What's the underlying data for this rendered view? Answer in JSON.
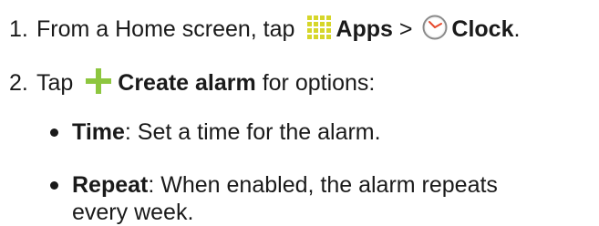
{
  "steps": [
    {
      "number": "1.",
      "pre_text": "From a Home screen, tap ",
      "apps_label": "Apps",
      "separator": " > ",
      "clock_label": "Clock",
      "end_text": "."
    },
    {
      "number": "2.",
      "pre_text": "Tap ",
      "action_label": "Create alarm",
      "post_text": " for options:"
    }
  ],
  "options": [
    {
      "term": "Time",
      "description": ": Set a time for the alarm."
    },
    {
      "term": "Repeat",
      "description": ": When enabled, the alarm repeats every week."
    }
  ],
  "icons": {
    "apps": "apps-grid-icon",
    "clock": "clock-icon",
    "create": "plus-icon"
  },
  "colors": {
    "text": "#1a1a1a",
    "apps_icon": "#d6d62a",
    "clock_icon_ring": "#8a8a8a",
    "clock_hands": "#e64a2e",
    "plus_icon": "#8dc63f"
  }
}
